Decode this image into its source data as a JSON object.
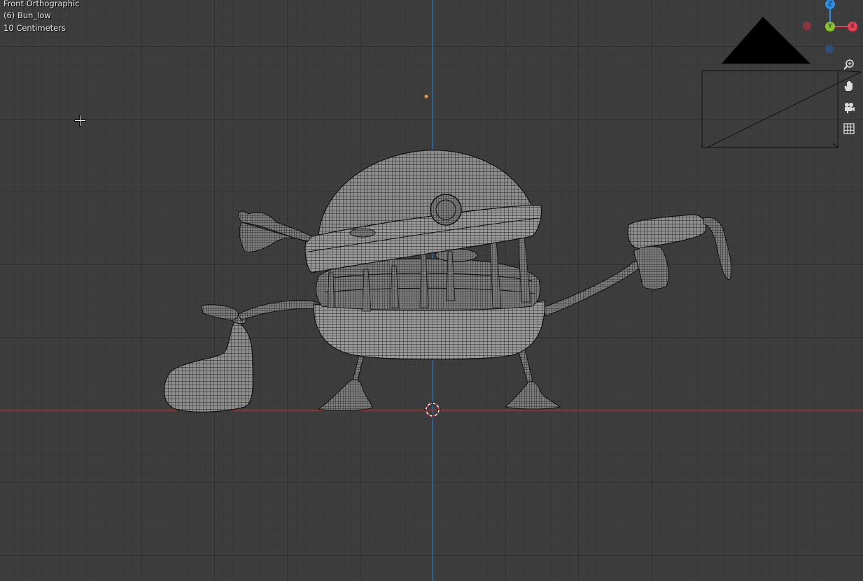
{
  "viewport": {
    "view_name": "Front Orthographic",
    "object_name": "(6) Bun_low",
    "grid_scale": "10 Centimeters"
  },
  "gizmo": {
    "z_label": "Z",
    "y_label": "Y",
    "x_label": "X",
    "colors": {
      "x": "#e84153",
      "y": "#8ac22e",
      "z": "#2c8fe3",
      "neg_x": "#8c3740",
      "neg_z": "#2e4f78"
    }
  },
  "navigation": {
    "zoom": "zoom-icon",
    "pan": "hand-icon",
    "camera": "camera-icon",
    "ortho": "grid-icon"
  },
  "colors": {
    "background": "#3d3d3d",
    "x_axis": "#b05157",
    "z_axis": "#4f82b8",
    "mesh_fill": "#8a8a8a",
    "wire": "#1c1c1c"
  }
}
